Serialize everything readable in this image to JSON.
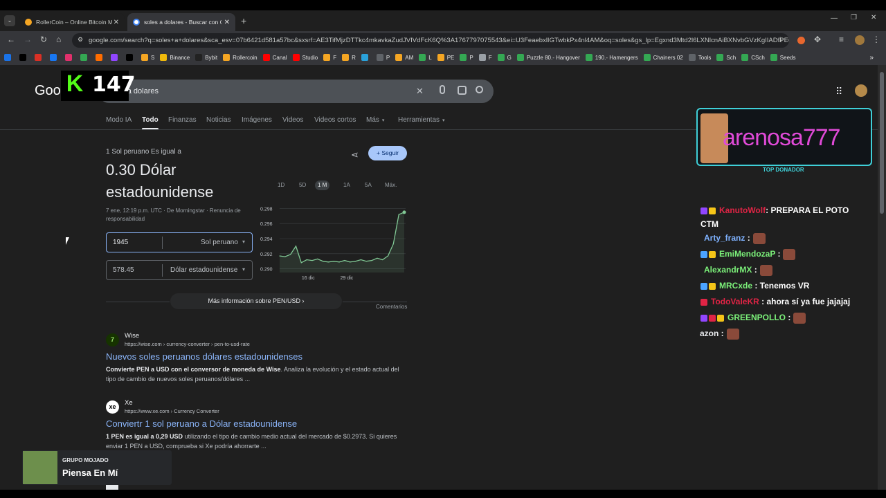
{
  "browser": {
    "tabs": [
      {
        "title": "RollerCoin – Online Bitcoin Mining",
        "close": "✕",
        "icon": "rollercoin-icon"
      },
      {
        "title": "soles a dolares - Buscar con Google",
        "close": "✕",
        "icon": "google-icon"
      }
    ],
    "new_tab": "+",
    "url": "google.com/search?q=soles+a+dolares&sca_esv=07b6421d581a57bc&sxsrf=AE3TifMjzDTTkc4mkavkaZudJVIVdFcK6Q%3A1767797075543&ei=U3FeaebxlIGTwbkPx4nl4AM&oq=soles&gs_lp=Egxnd3Mtd2l6LXNlcnAiBXNvbGVzKgIIADIPEC..."
  },
  "bookmarks": [
    {
      "label": "",
      "color": "#1a73e8"
    },
    {
      "label": "",
      "color": "#000000"
    },
    {
      "label": "",
      "color": "#d93025"
    },
    {
      "label": "",
      "color": "#1877f2"
    },
    {
      "label": "",
      "color": "#e1306c"
    },
    {
      "label": "",
      "color": "#34a853"
    },
    {
      "label": "",
      "color": "#ff6d00"
    },
    {
      "label": "",
      "color": "#9146ff"
    },
    {
      "label": "",
      "color": "#000000"
    },
    {
      "label": "S",
      "color": "#f5a623"
    },
    {
      "label": "Binance",
      "color": "#f0b90b"
    },
    {
      "label": "Bybit",
      "color": "#222222"
    },
    {
      "label": "Rollercoin",
      "color": "#f5a623"
    },
    {
      "label": "Canal",
      "color": "#ff0000"
    },
    {
      "label": "Studio",
      "color": "#ff0000"
    },
    {
      "label": "F",
      "color": "#f5a623"
    },
    {
      "label": "R",
      "color": "#f5a623"
    },
    {
      "label": "",
      "color": "#2aa1da"
    },
    {
      "label": "P",
      "color": "#5f6368"
    },
    {
      "label": "AM",
      "color": "#f5a623"
    },
    {
      "label": "L",
      "color": "#34a853"
    },
    {
      "label": "PE",
      "color": "#f5a623"
    },
    {
      "label": "P",
      "color": "#34a853"
    },
    {
      "label": "F",
      "color": "#9aa0a6"
    },
    {
      "label": "G",
      "color": "#34a853"
    },
    {
      "label": "Puzzle 80.- Hangover",
      "color": "#34a853"
    },
    {
      "label": "190.- Hamengers",
      "color": "#34a853"
    },
    {
      "label": "Chainers 02",
      "color": "#34a853"
    },
    {
      "label": "Tools",
      "color": "#5f6368"
    },
    {
      "label": "Sch",
      "color": "#34a853"
    },
    {
      "label": "CSch",
      "color": "#34a853"
    },
    {
      "label": "Seeds",
      "color": "#34a853"
    }
  ],
  "overlay": {
    "k_logo": "K",
    "counter": "147"
  },
  "google": {
    "logo": "Goog",
    "query": "soles a dolares",
    "tabs": [
      "Modo IA",
      "Todo",
      "Finanzas",
      "Noticias",
      "Imágenes",
      "Videos",
      "Videos cortos",
      "Más",
      "Herramientas"
    ],
    "active_tab": "Todo"
  },
  "converter": {
    "intro": "1 Sol peruano Es igual a",
    "result": "0.30 Dólar estadounidense",
    "result_line1": "0.30 Dólar",
    "result_line2": "estadounidense",
    "follow": "Seguir",
    "meta": "7 ene, 12:19 p.m. UTC · De Morningstar · Renuncia de responsabilidad",
    "from_value": "1945",
    "from_currency": "Sol peruano",
    "to_value": "578.45",
    "to_currency": "Dólar estadounidense",
    "more_info": "Más información sobre PEN/USD",
    "comments": "Comentarios",
    "ranges": [
      "1D",
      "5D",
      "1 M",
      "1A",
      "5A",
      "Máx."
    ],
    "active_range": "1 M"
  },
  "chart_data": {
    "type": "line",
    "title": "",
    "xlabel": "",
    "ylabel": "",
    "y_ticks": [
      "0.298",
      "0.296",
      "0.294",
      "0.292",
      "0.290"
    ],
    "x_ticks": [
      "16 dic",
      "29 dic"
    ],
    "ylim": [
      0.2895,
      0.2985
    ],
    "values": [
      0.2917,
      0.2916,
      0.2919,
      0.293,
      0.2908,
      0.2912,
      0.2911,
      0.2913,
      0.291,
      0.2909,
      0.291,
      0.2909,
      0.2911,
      0.2909,
      0.291,
      0.2912,
      0.291,
      0.2911,
      0.2914,
      0.2912,
      0.2917,
      0.2933,
      0.2972,
      0.2975
    ],
    "color": "#81c995"
  },
  "results": [
    {
      "site": "Wise",
      "path": "https://wise.com › currency-converter › pen-to-usd-rate",
      "title": "Nuevos soles peruanos dólares estadounidenses",
      "snippet_bold": "Convierte PEN a USD con el conversor de moneda de Wise",
      "snippet_rest": ". Analiza la evolución y el estado actual del tipo de cambio de nuevos soles peruanos/dólares ...",
      "icon_color": "#9fe870"
    },
    {
      "site": "Xe",
      "path": "https://www.xe.com › Currency Converter",
      "title": "Conviertr 1 sol peruano a Dólar estadounidense",
      "snippet_bold": "1 PEN es igual a 0,29 USD",
      "snippet_rest": " utilizando el tipo de cambio medio actual del mercado de $0.2973. Si quieres enviar 1 PEN a USD, comprueba si Xe podría ahorrarte ...",
      "icon_color": "#ffffff"
    }
  ],
  "stream": {
    "top_donor_name": "arenosa777",
    "top_donor_label": "TOP DONADOR",
    "chat": [
      {
        "user": "KanutoWolf",
        "color": "#e02445",
        "msg": ": PREPARA EL POTO CTM",
        "badges": [
          "#9146ff",
          "#f5c518"
        ]
      },
      {
        "user": "Arty_franz",
        "color": "#7fb2ff",
        "msg": " :",
        "badges": [],
        "emote": true
      },
      {
        "user": "EmiMendozaP",
        "color": "#7cf27a",
        "msg": " :",
        "badges": [
          "#4ba3ff",
          "#f5c518"
        ],
        "emote": true
      },
      {
        "user": "AlexandrMX",
        "color": "#7cf27a",
        "msg": " :",
        "badges": [],
        "emote": true
      },
      {
        "user": "MRCxde",
        "color": "#7cf27a",
        "msg": " : Tenemos VR",
        "badges": [
          "#4ba3ff",
          "#f5c518"
        ]
      },
      {
        "user": "TodoValeKR",
        "color": "#e02445",
        "msg": " : ahora sí ya fue jajajaj",
        "badges": [
          "#e02445"
        ]
      },
      {
        "user": "GREENPOLLO",
        "color": "#7cf27a",
        "msg": " :",
        "badges": [
          "#9146ff",
          "#e02445",
          "#f5c518"
        ],
        "emote": true
      },
      {
        "user": "azon",
        "color": "#e8eaed",
        "msg": " :",
        "badges": [],
        "emote": true
      }
    ],
    "now_playing_artist": "GRUPO MOJADO",
    "now_playing_song": "Piensa En Mí"
  }
}
